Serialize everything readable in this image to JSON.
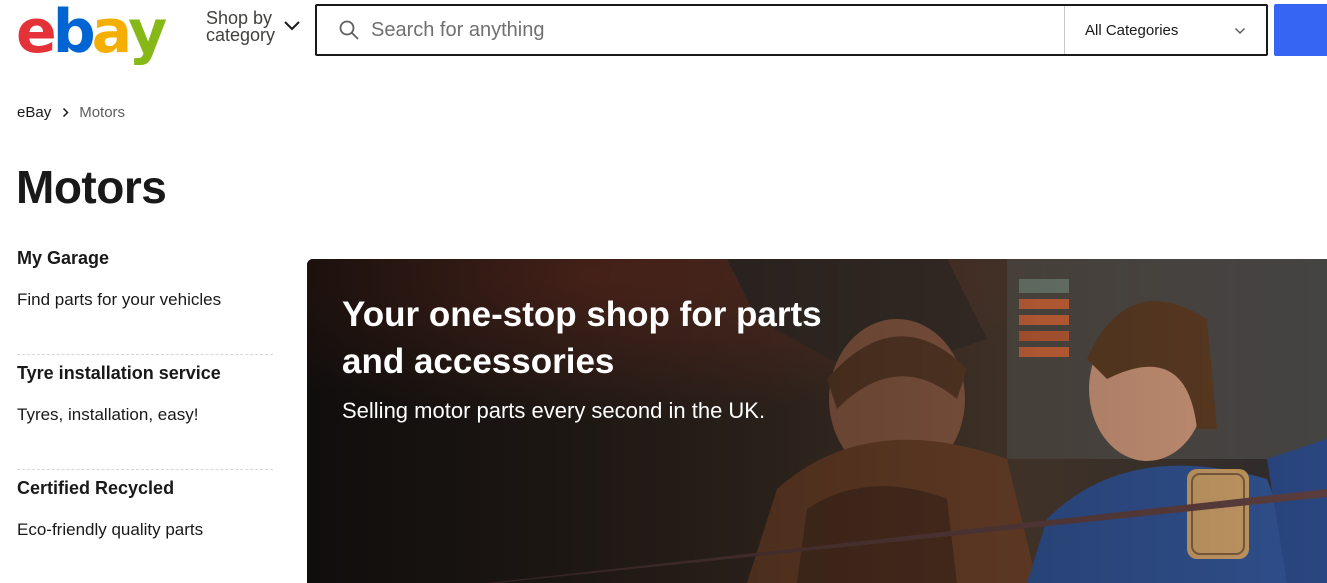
{
  "header": {
    "logo_letters": [
      {
        "char": "e",
        "color": "#e53238"
      },
      {
        "char": "b",
        "color": "#0064d2"
      },
      {
        "char": "a",
        "color": "#f5af02"
      },
      {
        "char": "y",
        "color": "#86b817"
      }
    ],
    "shop_by_line1": "Shop by",
    "shop_by_line2": "category",
    "search_placeholder": "Search for anything",
    "search_value": "",
    "category_selected": "All Categories",
    "search_button_color": "#3665f3"
  },
  "breadcrumb": {
    "home": "eBay",
    "current": "Motors"
  },
  "page_title": "Motors",
  "sidebar": {
    "items": [
      {
        "title": "My Garage",
        "subtitle": "Find parts for your vehicles"
      },
      {
        "title": "Tyre installation service",
        "subtitle": "Tyres, installation, easy!"
      },
      {
        "title": "Certified Recycled",
        "subtitle": "Eco-friendly quality parts"
      }
    ]
  },
  "hero": {
    "title": "Your one-stop shop for parts and accessories",
    "subtitle": "Selling motor parts every second in the UK."
  },
  "icons": {
    "search": "search-icon",
    "shop_by_chevron": "chevron-down-icon",
    "category_chevron": "chevron-down-icon",
    "breadcrumb_separator": "chevron-right-icon"
  }
}
